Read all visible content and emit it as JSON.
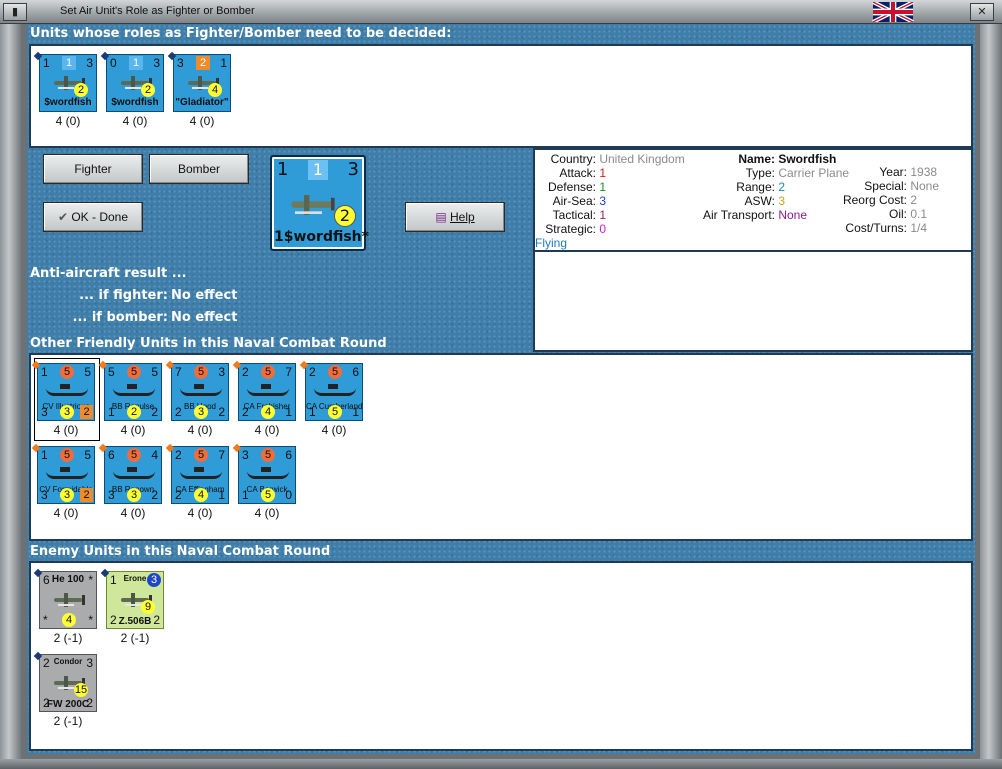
{
  "window": {
    "title": "Set Air Unit's Role as Fighter or Bomber"
  },
  "sections": {
    "pending_title": "Units whose roles as Fighter/Bomber need to be decided:",
    "friendly_title": "Other Friendly Units in this Naval Combat Round",
    "enemy_title": "Enemy Units in this Naval Combat Round"
  },
  "pending_units": [
    {
      "tl": "1",
      "sq": "1",
      "tr": "3",
      "name": "$wordfish",
      "yc": "2",
      "label": "4 (0)"
    },
    {
      "tl": "0",
      "sq": "1",
      "tr": "3",
      "name": "$wordfish",
      "yc": "2",
      "label": "4 (0)"
    },
    {
      "tl": "3",
      "sq": "2",
      "tr": "1",
      "name": "\"Gladiator\"",
      "yc": "4",
      "label": "4 (0)"
    }
  ],
  "buttons": {
    "fighter": "Fighter",
    "bomber": "Bomber",
    "ok": "OK - Done",
    "help": "Help"
  },
  "selected_unit": {
    "tl": "1",
    "sq": "1",
    "tr": "3",
    "yc": "2",
    "name": "1$wordfish*"
  },
  "aa": {
    "title": "Anti-aircraft result ...",
    "fighter_k": "... if fighter:",
    "fighter_v": "No effect",
    "bomber_k": "... if bomber:",
    "bomber_v": "No effect"
  },
  "info": {
    "country_k": "Country:",
    "country_v": "United Kingdom",
    "attack_k": "Attack:",
    "attack_v": "1",
    "defense_k": "Defense:",
    "defense_v": "1",
    "airsea_k": "Air-Sea:",
    "airsea_v": "3",
    "tactical_k": "Tactical:",
    "tactical_v": "1",
    "strategic_k": "Strategic:",
    "strategic_v": "0",
    "flying": "Flying",
    "name_k": "Name:",
    "name_v": "Swordfish",
    "type_k": "Type:",
    "type_v": "Carrier Plane",
    "range_k": "Range:",
    "range_v": "2",
    "asw_k": "ASW:",
    "asw_v": "3",
    "airtransport_k": "Air Transport:",
    "airtransport_v": "None",
    "year_k": "Year:",
    "year_v": "1938",
    "special_k": "Special:",
    "special_v": "None",
    "reorg_k": "Reorg Cost:",
    "reorg_v": "2",
    "oil_k": "Oil:",
    "oil_v": "0.1",
    "cost_k": "Cost/Turns:",
    "cost_v": "1/4"
  },
  "friendly_row1": [
    {
      "tl": "1",
      "c": "5",
      "tr": "5",
      "name": "CV Illustrious",
      "bl": "3",
      "yc": "3",
      "ob": "2",
      "label": "4 (0)"
    },
    {
      "tl": "5",
      "c": "5",
      "tr": "5",
      "name": "BB Repulse",
      "bl": "1",
      "yc": "2",
      "br": "2",
      "label": "4 (0)"
    },
    {
      "tl": "7",
      "c": "5",
      "tr": "3",
      "name": "BB Hood",
      "bl": "2",
      "yc": "3",
      "br": "2",
      "label": "4 (0)"
    },
    {
      "tl": "2",
      "c": "5",
      "tr": "7",
      "name": "CA Frobisher",
      "bl": "2",
      "yc": "4",
      "br": "1",
      "label": "4 (0)"
    },
    {
      "tl": "2",
      "c": "5",
      "tr": "6",
      "name": "CA Cumberland",
      "bl": "1",
      "yc": "5",
      "br": "1",
      "label": "4 (0)"
    }
  ],
  "friendly_row2": [
    {
      "tl": "1",
      "c": "5",
      "tr": "5",
      "name": "CV Formidable",
      "bl": "3",
      "yc": "3",
      "ob": "2",
      "label": "4 (0)"
    },
    {
      "tl": "6",
      "c": "5",
      "tr": "4",
      "name": "BB Renown",
      "bl": "3",
      "yc": "3",
      "br": "2",
      "label": "4 (0)"
    },
    {
      "tl": "2",
      "c": "5",
      "tr": "7",
      "name": "CA Effingham",
      "bl": "2",
      "yc": "4",
      "br": "1",
      "label": "4 (0)"
    },
    {
      "tl": "3",
      "c": "5",
      "tr": "6",
      "name": "CA Berwick",
      "bl": "1",
      "yc": "5",
      "br": "0",
      "label": "4 (0)"
    }
  ],
  "enemy_units": [
    {
      "tl": "6",
      "top": "He 100",
      "tr": "*",
      "bl": "*",
      "yc": "4",
      "br": "*",
      "label": "2 (-1)"
    },
    {
      "tl": "1",
      "top": "Erone",
      "circ": "3",
      "bl": "2",
      "name": "Z.506B",
      "yc": "9",
      "br": "2",
      "label": "2 (-1)"
    },
    {
      "tl": "2",
      "top": "Condor",
      "tr": "3",
      "bl": "2",
      "name": "FW 200C",
      "yc": "15",
      "br": "2",
      "label": "2 (-1)"
    }
  ],
  "colors": {
    "accent": "#2f9bd7",
    "background": "#3f7ea9"
  }
}
